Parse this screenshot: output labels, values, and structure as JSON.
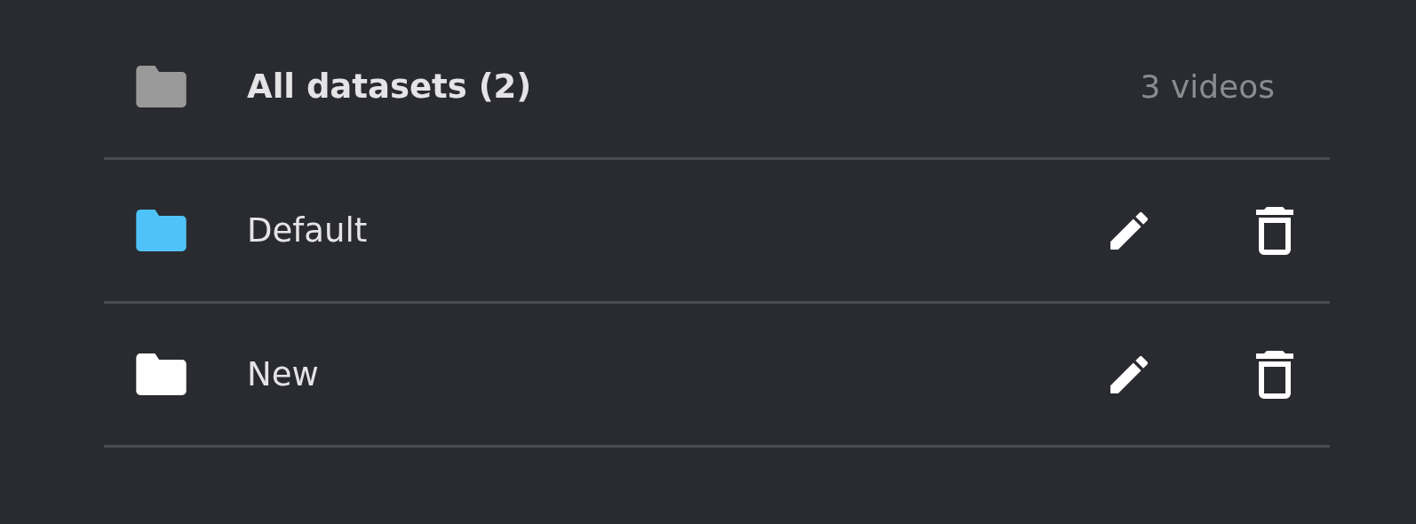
{
  "header": {
    "title": "All datasets (2)",
    "count": "3 videos"
  },
  "datasets": [
    {
      "name": "Default",
      "color": "#4fc3f7"
    },
    {
      "name": "New",
      "color": "#ffffff"
    }
  ]
}
